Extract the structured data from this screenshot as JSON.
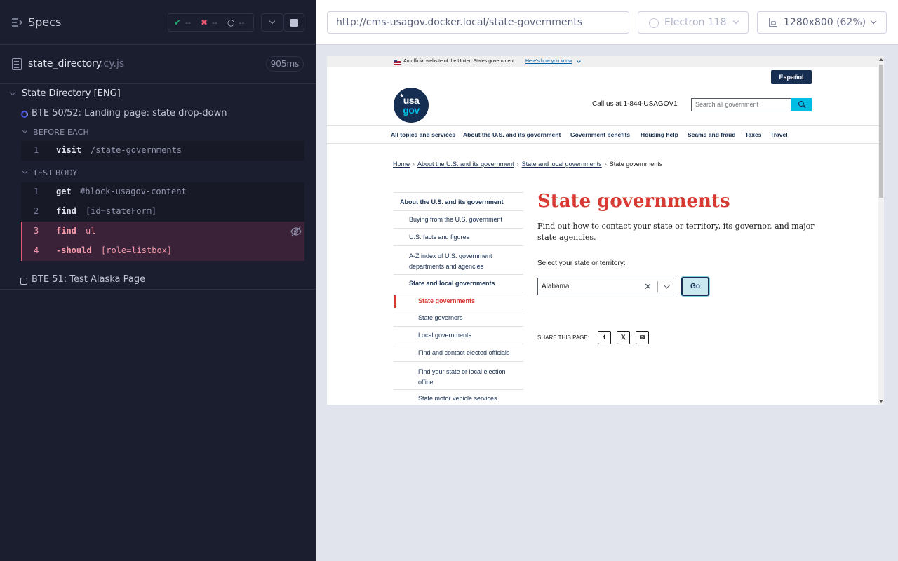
{
  "runner": {
    "title": "Specs",
    "stats": {
      "passed": "--",
      "failed": "--",
      "pending": "--"
    },
    "spec_file": {
      "name": "state_directory",
      "ext": ".cy.js",
      "duration": "905ms"
    },
    "suite": {
      "title": "State Directory [ENG]",
      "tests": [
        {
          "title": "BTE 50/52: Landing page: state drop-down",
          "state": "running",
          "before_each_label": "BEFORE EACH",
          "before_each": [
            {
              "num": "1",
              "name": "visit",
              "arg": "/state-governments"
            }
          ],
          "body_label": "TEST BODY",
          "body": [
            {
              "num": "1",
              "name": "get",
              "arg": "#block-usagov-content"
            },
            {
              "num": "2",
              "name": "find",
              "arg": "[id=stateForm]"
            },
            {
              "num": "3",
              "name": "find",
              "arg": "ul",
              "status": "failed"
            },
            {
              "num": "4",
              "name": "-should",
              "arg": "[role=listbox]",
              "status": "failed"
            }
          ]
        },
        {
          "title": "BTE 51: Test Alaska Page",
          "state": "pending"
        }
      ]
    }
  },
  "aut": {
    "url": "http://cms-usagov.docker.local/state-governments",
    "browser": "Electron 118",
    "viewport": "1280x800",
    "zoom": "(62%)"
  },
  "page": {
    "banner_text": "An official website of the United States government",
    "banner_link": "Here's how you know",
    "espanol": "Español",
    "logo_line1": "usa",
    "logo_line2": "gov",
    "call_us": "Call us at 1-844-USAGOV1",
    "search_placeholder": "Search all government",
    "nav": [
      "All topics and services",
      "About the U.S. and its government",
      "Government benefits",
      "Housing help",
      "Scams and fraud",
      "Taxes",
      "Travel"
    ],
    "breadcrumb": [
      "Home",
      "About the U.S. and its government",
      "State and local governments",
      "State governments"
    ],
    "sidenav": [
      "About the U.S. and its government",
      "Buying from the U.S. government",
      "U.S. facts and figures",
      "A-Z index of U.S. government departments and agencies",
      "State and local governments",
      "State governments",
      "State governors",
      "Local governments",
      "Find and contact elected officials",
      "Find your state or local election office",
      "State motor vehicle services"
    ],
    "heading": "State governments",
    "lead": "Find out how to contact your state or territory, its governor, and major state agencies.",
    "select_label": "Select your state or territory:",
    "select_value": "Alabama",
    "go_label": "Go",
    "share_label": "SHARE THIS PAGE:",
    "share_icons": [
      "facebook-icon",
      "x-icon",
      "email-icon"
    ]
  },
  "colors": {
    "runner_bg": "#1b1e2e",
    "fail_accent": "#e45770",
    "pass_accent": "#1fa971",
    "usagov_red": "#d83933",
    "usagov_navy": "#162e51",
    "usagov_cyan": "#00bde3"
  }
}
